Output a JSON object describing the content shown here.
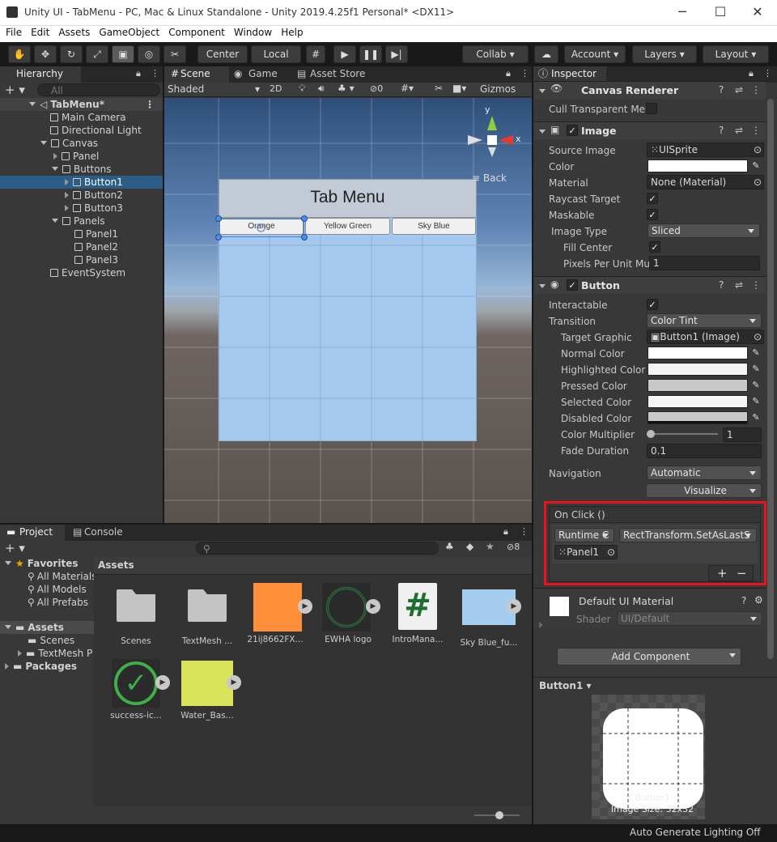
{
  "window": {
    "title": "Unity UI - TabMenu - PC, Mac & Linux Standalone - Unity 2019.4.25f1 Personal* <DX11>",
    "minimize": "─",
    "maximize": "☐",
    "close": "✕"
  },
  "menu": [
    "File",
    "Edit",
    "Assets",
    "GameObject",
    "Component",
    "Window",
    "Help"
  ],
  "toolbar": {
    "center": "Center",
    "local": "Local",
    "collab": "Collab",
    "account": "Account",
    "layers": "Layers",
    "layout": "Layout"
  },
  "hierarchy": {
    "tab": "Hierarchy",
    "search_placeholder": "All",
    "items": [
      {
        "label": "TabMenu*"
      },
      {
        "label": "Main Camera"
      },
      {
        "label": "Directional Light"
      },
      {
        "label": "Canvas"
      },
      {
        "label": "Panel"
      },
      {
        "label": "Buttons"
      },
      {
        "label": "Button1"
      },
      {
        "label": "Button2"
      },
      {
        "label": "Button3"
      },
      {
        "label": "Panels"
      },
      {
        "label": "Panel1"
      },
      {
        "label": "Panel2"
      },
      {
        "label": "Panel3"
      },
      {
        "label": "EventSystem"
      }
    ]
  },
  "scene": {
    "tabs": [
      "Scene",
      "Game",
      "Asset Store"
    ],
    "shading": "Shaded",
    "mode_2d": "2D",
    "hidden_count": "0",
    "gizmos": "Gizmos",
    "axis_y": "y",
    "axis_x": "x",
    "view_label": "Back",
    "ui_title": "Tab Menu",
    "buttons": [
      "Orange",
      "Yellow Green",
      "Sky Blue"
    ]
  },
  "project": {
    "tabs": [
      "Project",
      "Console"
    ],
    "hidden_count": "8",
    "tree": {
      "favorites": "Favorites",
      "fav_items": [
        "All Materials",
        "All Models",
        "All Prefabs"
      ],
      "assets": "Assets",
      "asset_items": [
        "Scenes",
        "TextMesh P"
      ],
      "packages": "Packages"
    },
    "breadcrumb": "Assets",
    "assets": [
      {
        "name": "Scenes",
        "kind": "folder"
      },
      {
        "name": "TextMesh ...",
        "kind": "folder"
      },
      {
        "name": "21ij8662FX...",
        "kind": "orange",
        "color": "#ff8e3a"
      },
      {
        "name": "EWHA logo",
        "kind": "logo"
      },
      {
        "name": "IntroMana...",
        "kind": "script",
        "glyph": "#"
      },
      {
        "name": "Sky Blue_fu...",
        "kind": "skyblue",
        "color": "#a5cdf0"
      },
      {
        "name": "success-ic...",
        "kind": "success"
      },
      {
        "name": "Water_Bas...",
        "kind": "yellow",
        "color": "#d8e35a"
      }
    ]
  },
  "inspector": {
    "tab": "Inspector",
    "canvas_renderer": {
      "title": "Canvas Renderer",
      "cull_label": "Cull Transparent Mes"
    },
    "image": {
      "title": "Image",
      "source_image_label": "Source Image",
      "source_image": "UISprite",
      "color_label": "Color",
      "material_label": "Material",
      "material": "None (Material)",
      "raycast_label": "Raycast Target",
      "maskable_label": "Maskable",
      "image_type_label": "Image Type",
      "image_type": "Sliced",
      "fill_center_label": "Fill Center",
      "ppu_label": "Pixels Per Unit Mul",
      "ppu": "1"
    },
    "button": {
      "title": "Button",
      "interactable_label": "Interactable",
      "transition_label": "Transition",
      "transition": "Color Tint",
      "target_graphic_label": "Target Graphic",
      "target_graphic": "Button1 (Image)",
      "normal_label": "Normal Color",
      "highlighted_label": "Highlighted Color",
      "pressed_label": "Pressed Color",
      "selected_label": "Selected Color",
      "disabled_label": "Disabled Color",
      "multiplier_label": "Color Multiplier",
      "multiplier": "1",
      "fade_label": "Fade Duration",
      "fade": "0.1",
      "navigation_label": "Navigation",
      "navigation": "Automatic",
      "visualize": "Visualize"
    },
    "on_click": {
      "title": "On Click ()",
      "runtime": "Runtime C",
      "function": "RectTransform.SetAsLastS",
      "object": "Panel1",
      "add": "+",
      "remove": "−"
    },
    "material": {
      "title": "Default UI Material",
      "shader_label": "Shader",
      "shader": "UI/Default"
    },
    "add_component": "Add Component",
    "preview": {
      "dropdown": "Button1",
      "caption": "Button1",
      "size": "Image Size: 32x32"
    }
  },
  "status": {
    "text": "Auto Generate Lighting Off"
  },
  "colors": {
    "highlight_box": "#e8141c",
    "selection": "#2c5d87",
    "scene_panel": "#a5c9ee"
  }
}
